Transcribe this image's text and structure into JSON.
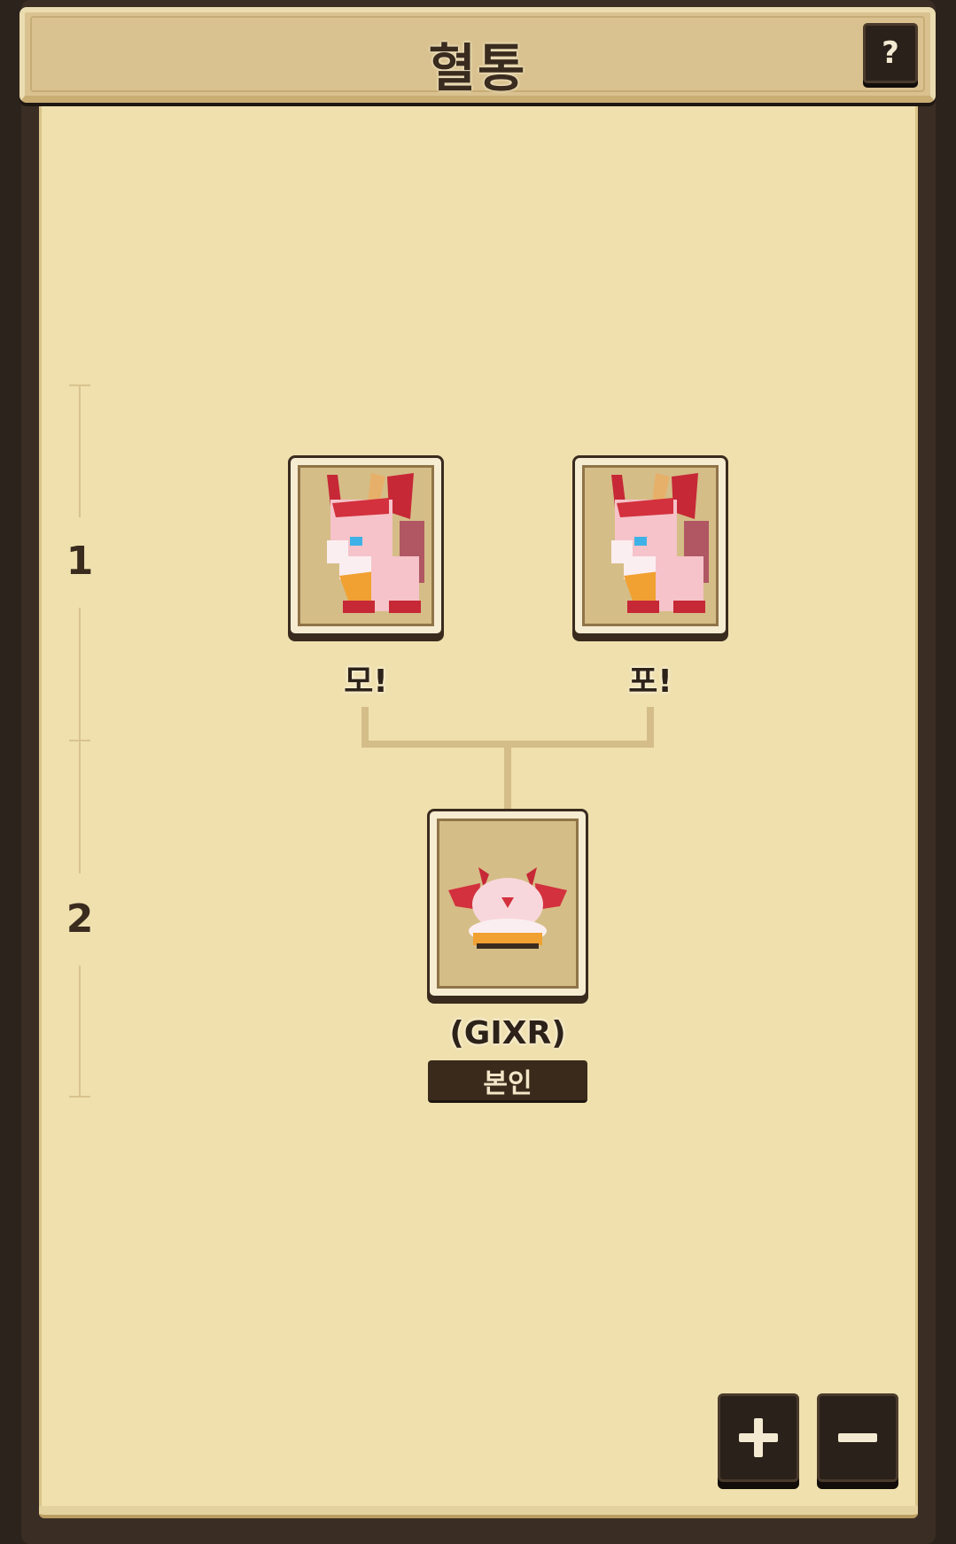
{
  "header": {
    "title": "혈통",
    "help_label": "?"
  },
  "generations": [
    {
      "label": "1"
    },
    {
      "label": "2"
    }
  ],
  "parents": [
    {
      "name": "모!",
      "icon": "pink-dragon-fox-adult-sprite"
    },
    {
      "name": "포!",
      "icon": "pink-dragon-fox-adult-sprite"
    }
  ],
  "child": {
    "name": "(GIXR)",
    "badge": "본인",
    "icon": "pink-dragon-fox-baby-sprite"
  },
  "zoom": {
    "in_icon": "plus-icon",
    "out_icon": "minus-icon"
  },
  "colors": {
    "panel": "#efe0ae",
    "frame": "#3a2d23",
    "card_bg": "#d5bd87",
    "accent_pink": "#f2b5c0",
    "accent_red": "#d2313d"
  }
}
